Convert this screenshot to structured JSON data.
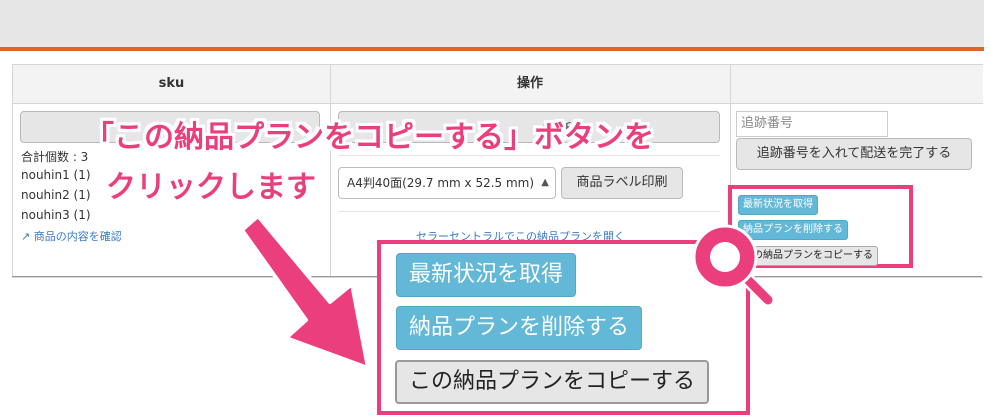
{
  "table": {
    "col_sku_header": "sku",
    "col_action_header": "操作"
  },
  "sku_cell": {
    "total_count": "合計個数 : 3",
    "items": [
      "nouhin1 (1)",
      "nouhin2 (1)",
      "nouhin3 (1)"
    ],
    "confirm_link": "商品の内容を確認"
  },
  "action_cell": {
    "label_size_select": "A4判40面(29.7 mm x 52.5 mm)",
    "print_label_button": "商品ラベル印刷",
    "top_button_partial": "ベル印",
    "seller_central_link": "セラーセントラルでこの納品プランを開く"
  },
  "shipping_cell": {
    "tracking_placeholder": "追跡番号",
    "complete_shipping_button": "追跡番号を入れて配送を完了する",
    "refresh_status_button": "最新状況を取得",
    "delete_plan_button": "納品プランを削除する",
    "copy_plan_button": "この納品プランをコピーする"
  },
  "callout": {
    "line1": "「この納品プランをコピーする」ボタンを",
    "line2": "クリックします"
  },
  "colors": {
    "accent": "#ea3f7c",
    "info_button": "#62b8d6",
    "header_line": "#e0632a"
  }
}
